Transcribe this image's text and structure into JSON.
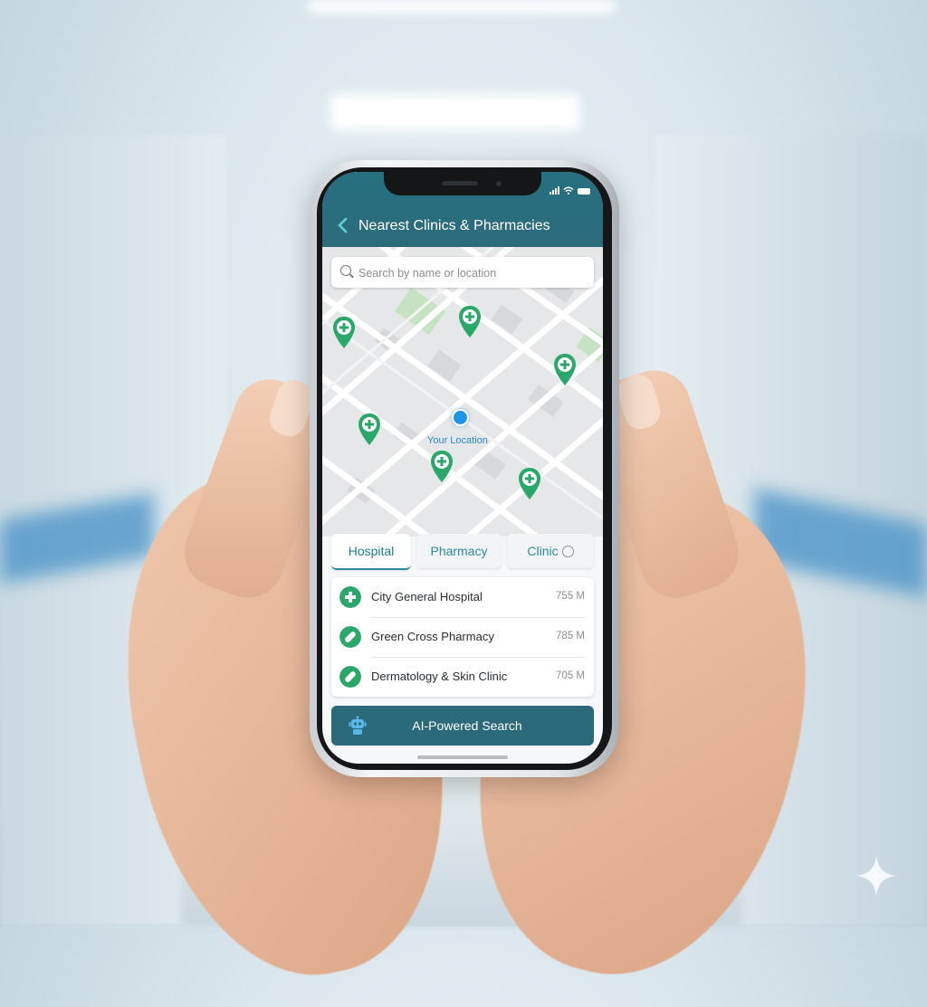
{
  "header": {
    "title": "Nearest Clinics & Pharmacies"
  },
  "search": {
    "placeholder": "Search by name or location"
  },
  "map": {
    "your_location_label": "Your Location"
  },
  "tabs": [
    {
      "label": "Hospital",
      "active": true
    },
    {
      "label": "Pharmacy",
      "active": false
    },
    {
      "label": "Clinic",
      "active": false
    }
  ],
  "results": [
    {
      "name": "City General Hospital",
      "distance": "755 M",
      "icon": "medical-cross-icon"
    },
    {
      "name": "Green Cross Pharmacy",
      "distance": "785 M",
      "icon": "pill-icon"
    },
    {
      "name": "Dermatology & Skin Clinic",
      "distance": "705 M",
      "icon": "pill-icon"
    }
  ],
  "ai_button": {
    "label": "AI-Powered Search",
    "icon": "robot-icon"
  },
  "colors": {
    "header": "#2d6b7b",
    "accent": "#2b8c96",
    "pin": "#2aa86a",
    "user_dot": "#1f95e6",
    "ai_button": "#2a6a7b"
  }
}
